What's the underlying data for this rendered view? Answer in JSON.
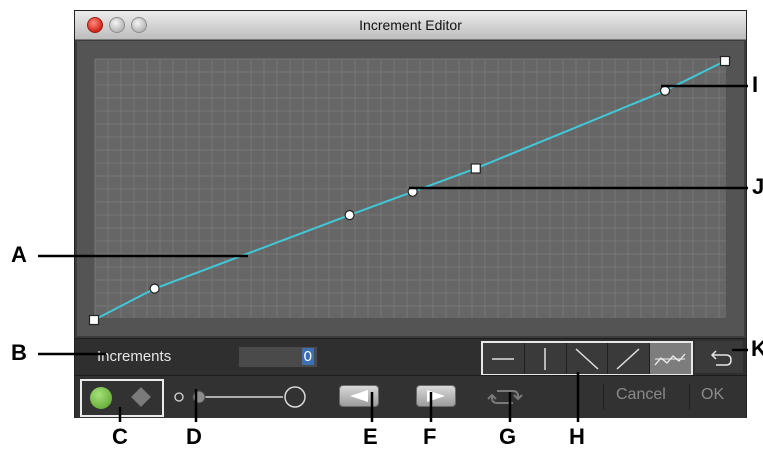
{
  "window": {
    "title": "Increment Editor"
  },
  "graph": {
    "points": [
      [
        0.0,
        0.0
      ],
      [
        0.096,
        0.121
      ],
      [
        0.405,
        0.405
      ],
      [
        0.505,
        0.495
      ],
      [
        0.605,
        0.585
      ],
      [
        0.905,
        0.885
      ],
      [
        1.0,
        1.0
      ]
    ],
    "curve_color": "#40c8d8"
  },
  "increments": {
    "label": "Increments",
    "value": "0"
  },
  "shape_buttons": [
    {
      "icon": "horizontal-line-icon"
    },
    {
      "icon": "vertical-line-icon"
    },
    {
      "icon": "descending-line-icon"
    },
    {
      "icon": "ascending-line-icon"
    },
    {
      "icon": "stepped-line-icon"
    }
  ],
  "bottom": {
    "cancel_label": "Cancel",
    "ok_label": "OK"
  },
  "callouts": {
    "A": "A",
    "B": "B",
    "C": "C",
    "D": "D",
    "E": "E",
    "F": "F",
    "G": "G",
    "H": "H",
    "I": "I",
    "J": "J",
    "K": "K"
  },
  "colors": {
    "accent_green": "#6bb33c",
    "selection_blue": "#3d6fb3"
  }
}
